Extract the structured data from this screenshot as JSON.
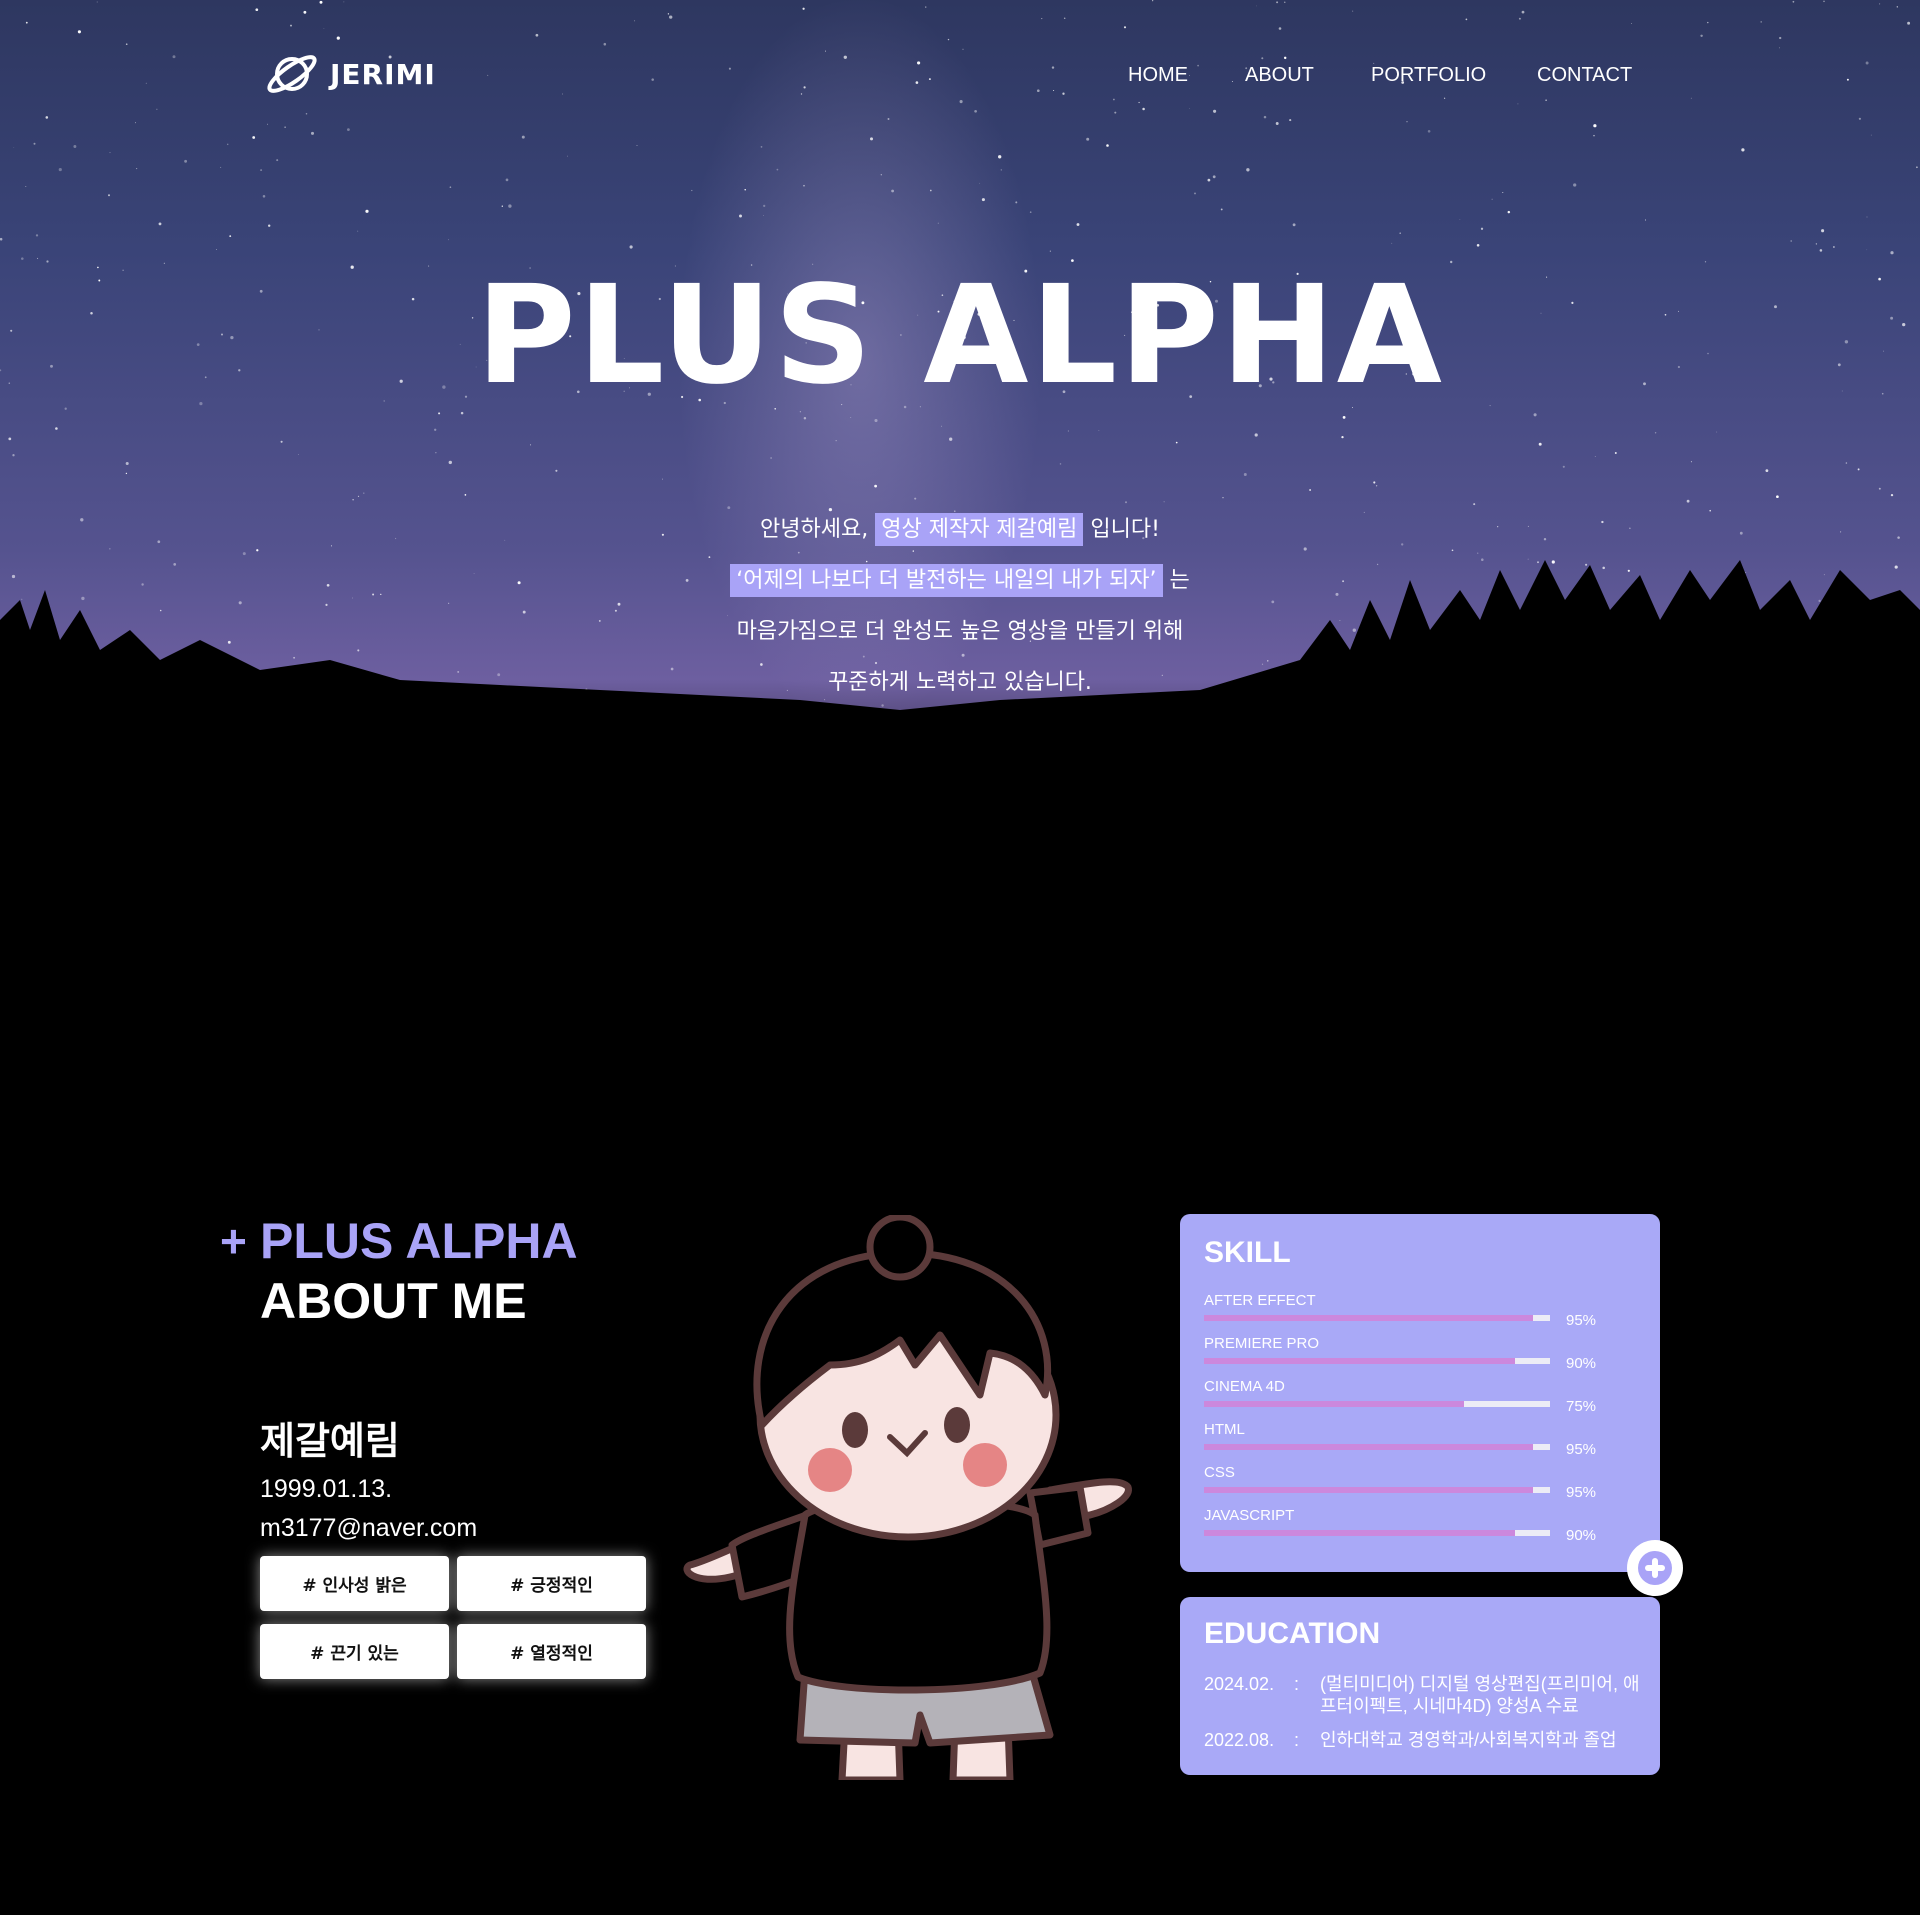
{
  "header": {
    "logo_text": "JERIMI",
    "nav": [
      "HOME",
      "ABOUT",
      "PORTFOLIO",
      "CONTACT"
    ]
  },
  "hero": {
    "title": "PLUS ALPHA",
    "line1_pre": "안녕하세요,",
    "line1_hl": "영상 제작자 제갈예림",
    "line1_post": "입니다!",
    "line2_hl": "‘어제의 나보다 더 발전하는 내일의 내가 되자’",
    "line2_post": "는",
    "line3": "마음가짐으로 더 완성도 높은 영상을 만들기 위해",
    "line4": "꾸준하게 노력하고 있습니다."
  },
  "about": {
    "plus": "+",
    "title_line1": "PLUS ALPHA",
    "title_line2": "ABOUT ME",
    "name": "제갈예림",
    "birth": "1999.01.13.",
    "email": "m3177@naver.com",
    "tags": [
      "# 인사성 밝은",
      "# 긍정적인",
      "# 끈기 있는",
      "# 열정적인"
    ]
  },
  "skill": {
    "title": "SKILL",
    "items": [
      {
        "name": "AFTER EFFECT",
        "percent": 95,
        "label": "95%"
      },
      {
        "name": "PREMIERE PRO",
        "percent": 90,
        "label": "90%"
      },
      {
        "name": "CINEMA 4D",
        "percent": 75,
        "label": "75%"
      },
      {
        "name": "HTML",
        "percent": 95,
        "label": "95%"
      },
      {
        "name": "CSS",
        "percent": 95,
        "label": "95%"
      },
      {
        "name": "JAVASCRIPT",
        "percent": 90,
        "label": "90%"
      }
    ]
  },
  "education": {
    "title": "EDUCATION",
    "items": [
      {
        "date": "2024.02.",
        "colon": ":",
        "text": "(멀티미디어) 디지털 영상편집(프리미어, 애프터이펙트, 시네마4D) 양성A 수료"
      },
      {
        "date": "2022.08.",
        "colon": ":",
        "text": "인하대학교 경영학과/사회복지학과 졸업"
      }
    ]
  },
  "colors": {
    "accent": "#a9a3f7",
    "card": "#a9a9f7",
    "skill_fill": "#cc88dd"
  }
}
